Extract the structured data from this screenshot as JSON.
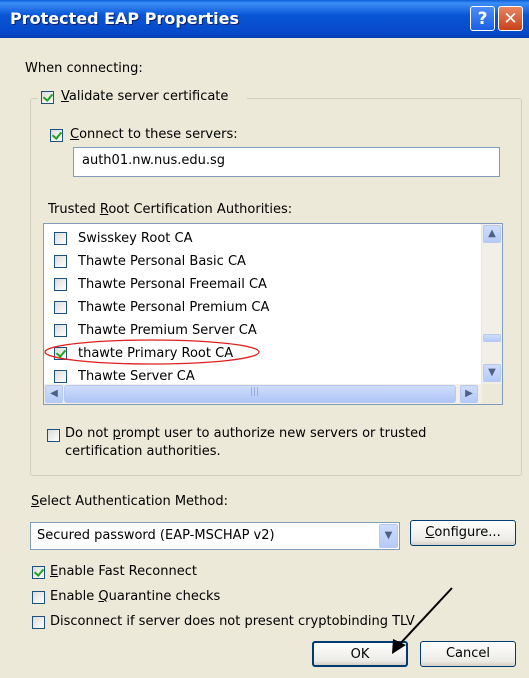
{
  "window": {
    "title": "Protected EAP Properties",
    "help_glyph": "?",
    "close_glyph": "✕"
  },
  "when_connecting": "When connecting:",
  "validate": {
    "checked": true,
    "prefix": "",
    "access": "V",
    "suffix": "alidate server certificate"
  },
  "connect_servers": {
    "checked": true,
    "prefix": "",
    "access": "C",
    "suffix": "onnect to these servers:",
    "value": "auth01.nw.nus.edu.sg"
  },
  "trusted_root": {
    "prefix": "Trusted ",
    "access": "R",
    "suffix": "oot Certification Authorities:",
    "items": [
      {
        "label": "Swisskey Root CA",
        "checked": false
      },
      {
        "label": "Thawte Personal Basic CA",
        "checked": false
      },
      {
        "label": "Thawte Personal Freemail CA",
        "checked": false
      },
      {
        "label": "Thawte Personal Premium CA",
        "checked": false
      },
      {
        "label": "Thawte Premium Server CA",
        "checked": false
      },
      {
        "label": "thawte Primary Root CA",
        "checked": true
      },
      {
        "label": "Thawte Server CA",
        "checked": false
      }
    ],
    "hscroll_grip": "|||"
  },
  "no_prompt": {
    "checked": false,
    "line1_prefix": "Do not ",
    "access": "p",
    "line1_suffix": "rompt user to authorize new servers or trusted",
    "line2": "certification authorities."
  },
  "auth_method": {
    "prefix": "",
    "access": "S",
    "suffix": "elect Authentication Method:",
    "selected": "Secured password (EAP-MSCHAP v2)",
    "configure_access": "C",
    "configure_suffix": "onfigure..."
  },
  "fast_reconnect": {
    "checked": true,
    "access": "E",
    "suffix": "nable Fast Reconnect"
  },
  "quarantine": {
    "checked": false,
    "prefix": "Enable ",
    "access": "Q",
    "suffix": "uarantine checks"
  },
  "cryptobinding": {
    "checked": false,
    "label": "Disconnect if server does not present cryptobinding TLV"
  },
  "buttons": {
    "ok": "OK",
    "cancel": "Cancel"
  },
  "colors": {
    "titlebar": "#0856d6",
    "dialog_bg": "#ece9d8",
    "annotation_ellipse": "#e02020"
  }
}
